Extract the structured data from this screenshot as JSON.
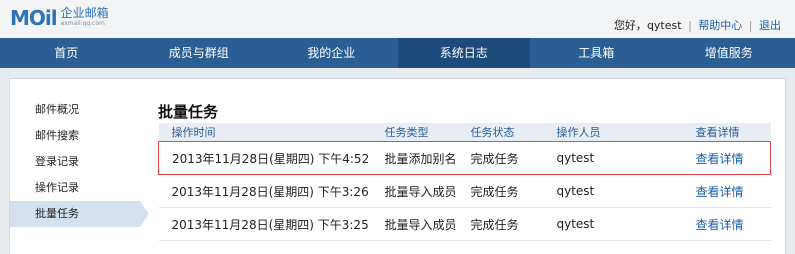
{
  "logo": {
    "mark": "MOil",
    "cn": "企业邮箱",
    "sub": "exmail.qq.com"
  },
  "userbar": {
    "greeting": "您好，",
    "username": "qytest",
    "sep": "|",
    "help": "帮助中心",
    "logout": "退出"
  },
  "nav": {
    "items": [
      "首页",
      "成员与群组",
      "我的企业",
      "系统日志",
      "工具箱",
      "增值服务"
    ],
    "active_index": 3
  },
  "sidebar": {
    "items": [
      "邮件概况",
      "邮件搜索",
      "登录记录",
      "操作记录",
      "批量任务"
    ],
    "active_index": 4
  },
  "main": {
    "title": "批量任务",
    "columns": [
      "操作时间",
      "任务类型",
      "任务状态",
      "操作人员",
      "查看详情"
    ],
    "rows": [
      {
        "time": "2013年11月28日(星期四) 下午4:52",
        "type": "批量添加别名",
        "status": "完成任务",
        "operator": "qytest",
        "detail": "查看详情"
      },
      {
        "time": "2013年11月28日(星期四) 下午3:26",
        "type": "批量导入成员",
        "status": "完成任务",
        "operator": "qytest",
        "detail": "查看详情"
      },
      {
        "time": "2013年11月28日(星期四) 下午3:25",
        "type": "批量导入成员",
        "status": "完成任务",
        "operator": "qytest",
        "detail": "查看详情"
      }
    ],
    "highlighted_row": 0
  },
  "colors": {
    "nav_bg": "#2a5e95",
    "nav_active": "#1d4b7c",
    "link": "#1b5fa8",
    "highlight_border": "#e54545"
  }
}
